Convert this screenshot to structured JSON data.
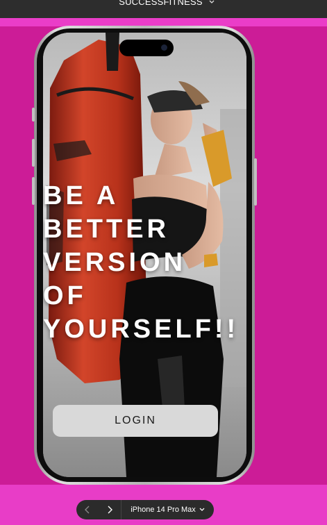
{
  "app": {
    "title": "SUCCESSFITNESS"
  },
  "hero": {
    "headline_lines": [
      "BE A",
      "BETTER",
      "VERSION",
      "OF",
      "YOURSELF!!"
    ]
  },
  "login_label": "LOGIN",
  "device_toolbar": {
    "device": "iPhone 14 Pro Max"
  },
  "colors": {
    "canvas_pink": "#e63cc6",
    "frame_magenta": "#cc1c97",
    "topbar": "#2d2d2d",
    "button_gray": "#d9d9d9",
    "bag_red": "#c8361e"
  },
  "icons": [
    "chevron-down-icon",
    "back-arrow-icon",
    "forward-arrow-icon",
    "caret-down-icon"
  ]
}
